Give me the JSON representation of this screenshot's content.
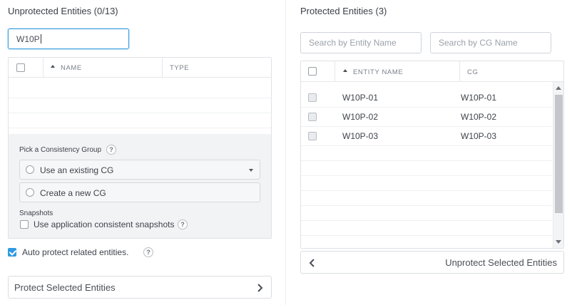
{
  "left": {
    "title": "Unprotected Entities (0/13)",
    "search_value": "W10P",
    "table": {
      "columns": [
        "NAME",
        "TYPE"
      ]
    },
    "consistency": {
      "heading": "Pick a Consistency Group",
      "help": "?",
      "option_existing": "Use an existing CG",
      "option_new": "Create a new CG",
      "snapshots_heading": "Snapshots",
      "snapshots_label": "Use application consistent snapshots",
      "snapshots_help": "?"
    },
    "auto_protect": {
      "label": "Auto protect related entities.",
      "help": "?",
      "checked": true
    },
    "protect_button": "Protect Selected Entities"
  },
  "right": {
    "title": "Protected Entities (3)",
    "search_entity_placeholder": "Search by Entity Name",
    "search_cg_placeholder": "Search by CG Name",
    "table": {
      "columns": [
        "ENTITY NAME",
        "CG"
      ],
      "rows": [
        {
          "name": "W10P-01",
          "cg": "W10P-01"
        },
        {
          "name": "W10P-02",
          "cg": "W10P-02"
        },
        {
          "name": "W10P-03",
          "cg": "W10P-03"
        }
      ]
    },
    "unprotect_button": "Unprotect Selected Entities"
  },
  "colors": {
    "accent": "#2f9ae0",
    "focus_border": "#3a9ee0"
  }
}
